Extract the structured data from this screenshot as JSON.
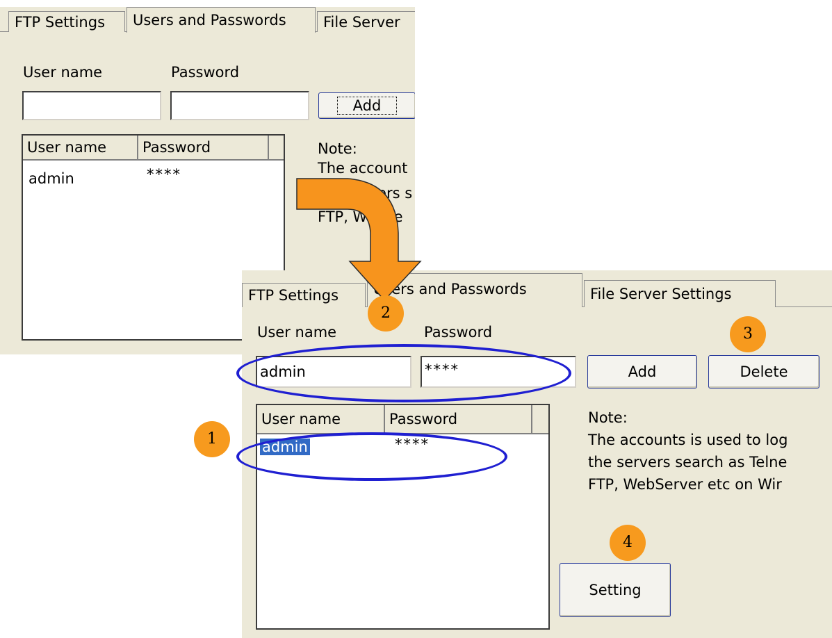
{
  "back": {
    "tabs": [
      "FTP Settings",
      "Users and Passwords",
      "File Server"
    ],
    "labels": {
      "username": "User name",
      "password": "Password"
    },
    "inputs": {
      "username": "",
      "password": ""
    },
    "add_button": "Add",
    "list": {
      "headers": [
        "User name",
        "Password"
      ],
      "rows": [
        {
          "user": "admin",
          "password": "****"
        }
      ]
    },
    "note": [
      "Note:",
      "The account",
      "the servers s",
      "FTP, WebSe"
    ]
  },
  "front": {
    "tabs": [
      "FTP Settings",
      "Users and Passwords",
      "File Server Settings"
    ],
    "labels": {
      "username": "User name",
      "password": "Password"
    },
    "inputs": {
      "username": "admin",
      "password": "****"
    },
    "buttons": {
      "add": "Add",
      "delete": "Delete",
      "setting": "Setting"
    },
    "list": {
      "headers": [
        "User name",
        "Password"
      ],
      "rows": [
        {
          "user": "admin",
          "password": "****",
          "selected": true
        }
      ]
    },
    "note": [
      "Note:",
      "The accounts is used to log",
      "the servers search as Telne",
      "FTP, WebServer etc on Wir"
    ]
  },
  "annotations": {
    "steps": [
      "1",
      "2",
      "3",
      "4"
    ],
    "arrow_color": "#f7941d",
    "ellipse_color": "#1f1fd1",
    "badge_color": "#f79a1e"
  }
}
